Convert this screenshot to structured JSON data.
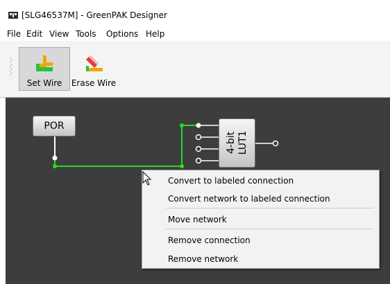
{
  "window": {
    "title": "[SLG46537M] - GreenPAK Designer",
    "app_icon": "greenpak-chip-icon"
  },
  "menubar": [
    "File",
    "Edit",
    "View",
    "Tools",
    "Options",
    "Help"
  ],
  "toolbar": {
    "set_wire": {
      "label": "Set Wire",
      "icon": "set-wire-icon",
      "active": true
    },
    "erase_wire": {
      "label": "Erase Wire",
      "icon": "erase-wire-icon",
      "active": false
    }
  },
  "canvas": {
    "por_block": {
      "label": "POR"
    },
    "lut_block": {
      "label": "4-bit LUT1"
    },
    "wire_color": "#22dd22",
    "background": "#3d3d3d"
  },
  "context_menu": {
    "items": [
      "Convert to labeled connection",
      "Convert network to labeled connection",
      "Move network",
      "Remove connection",
      "Remove network"
    ]
  },
  "colors": {
    "accent_wire": "#22dd22",
    "toolbar_active": "#d8d8d8",
    "menu_bg": "#f2f2f2"
  }
}
